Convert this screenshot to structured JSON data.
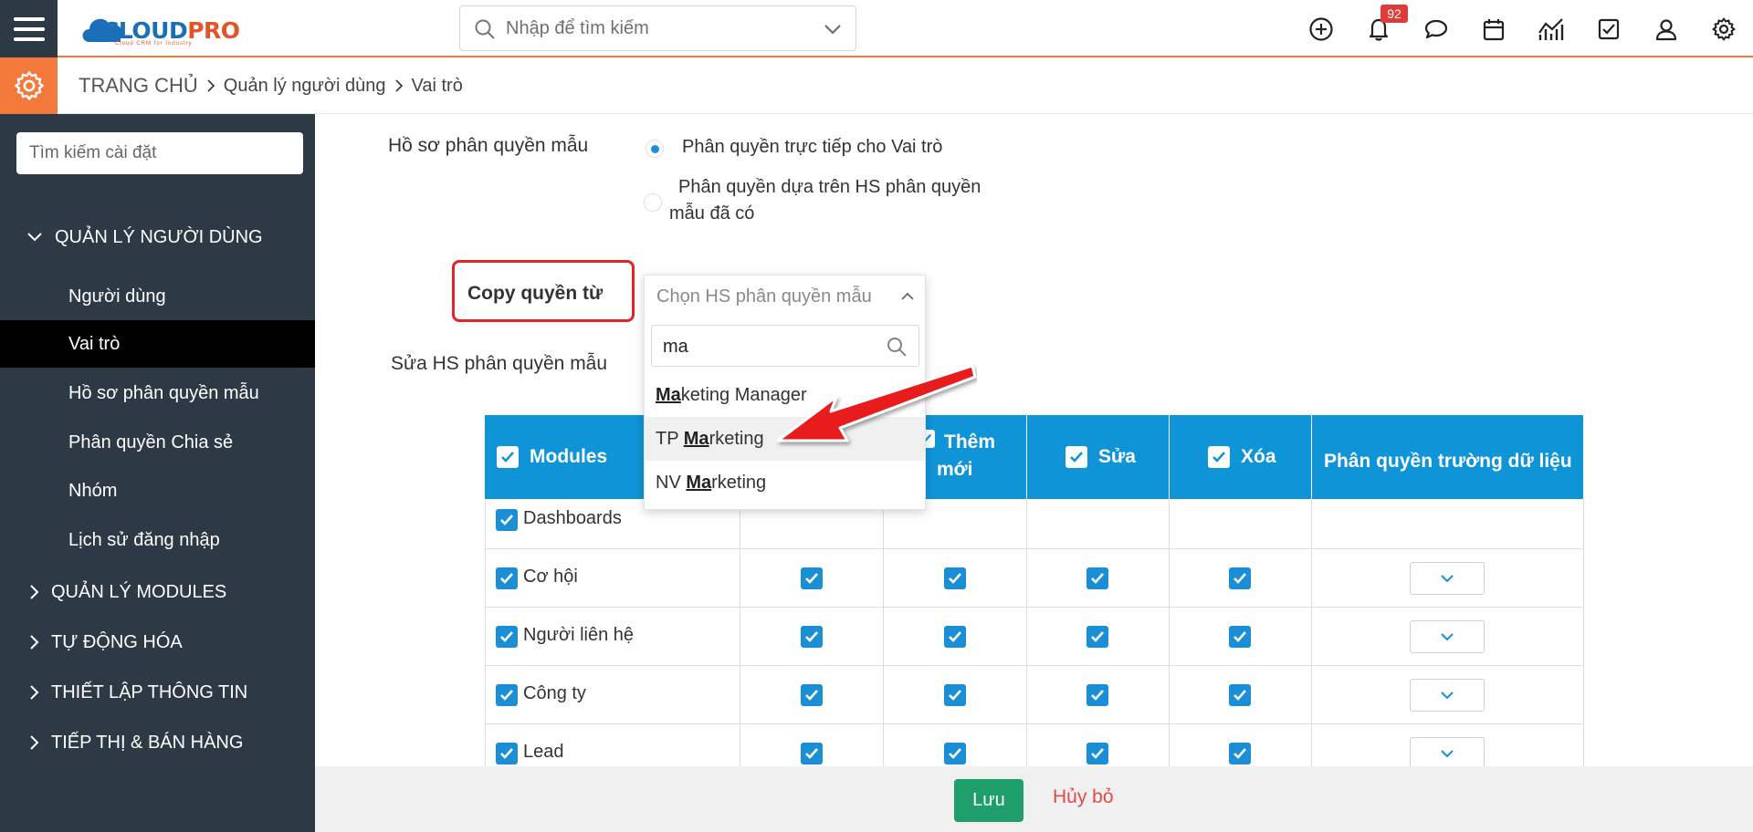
{
  "header": {
    "logo_main": "CLOUD",
    "logo_pro": "PRO",
    "logo_tagline": "Cloud CRM for Industry",
    "search_placeholder": "Nhập để tìm kiếm",
    "notification_count": "92"
  },
  "breadcrumb": {
    "home": "TRANG CHỦ",
    "level1": "Quản lý người dùng",
    "level2": "Vai trò"
  },
  "sidebar": {
    "search_placeholder": "Tìm kiếm cài đặt",
    "section_users": "QUẢN LÝ NGƯỜI DÙNG",
    "items": [
      "Người dùng",
      "Vai trò",
      "Hồ sơ phân quyền mẫu",
      "Phân quyền Chia sẻ",
      "Nhóm",
      "Lịch sử đăng nhập"
    ],
    "sections": [
      "QUẢN LÝ MODULES",
      "TỰ ĐỘNG HÓA",
      "THIẾT LẬP THÔNG TIN",
      "TIẾP THỊ & BÁN HÀNG"
    ]
  },
  "form": {
    "profile_label": "Hồ sơ phân quyền mẫu",
    "radio_direct": "Phân quyền trực tiếp cho Vai trò",
    "radio_existing_line1": "Phân quyền dựa trên HS phân quyền",
    "radio_existing_line2": "mẫu đã có",
    "copy_label": "Copy quyền từ",
    "edit_label": "Sửa HS phân quyền mẫu"
  },
  "dropdown": {
    "placeholder": "Chọn HS phân quyền mẫu",
    "search_value": "ma",
    "options": [
      {
        "match": "Ma",
        "prefix": "",
        "rest": "keting Manager"
      },
      {
        "match": "Ma",
        "prefix": "TP ",
        "rest": "rketing"
      },
      {
        "match": "Ma",
        "prefix": "NV ",
        "rest": "rketing"
      }
    ]
  },
  "table": {
    "col_modules": "Modules",
    "col_add_line1": "Thêm",
    "col_add_line2": "mới",
    "col_edit": "Sửa",
    "col_delete": "Xóa",
    "col_fields": "Phân quyền trường dữ liệu",
    "rows": [
      "Dashboards",
      "Cơ hội",
      "Người liên hệ",
      "Công ty",
      "Lead"
    ]
  },
  "footer": {
    "save": "Lưu",
    "cancel": "Hủy bỏ"
  },
  "colors": {
    "accent_orange": "#f47a3b",
    "sidebar_bg": "#2d3a46",
    "table_header": "#0f94d8",
    "checkbox": "#1a8fd6",
    "save_green": "#1e9e6b",
    "highlight_red": "#e02525"
  }
}
